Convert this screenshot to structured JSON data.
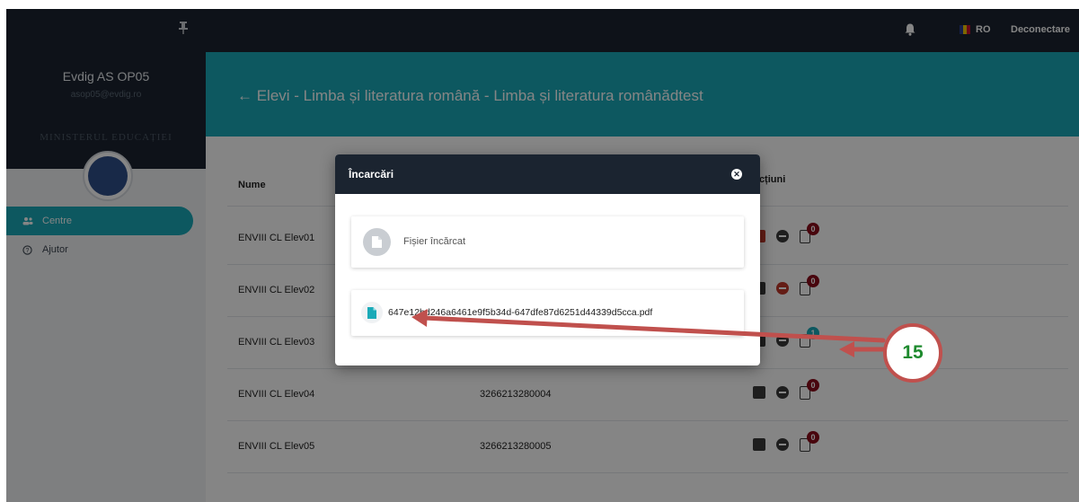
{
  "app": {
    "user_name": "Evdig AS OP05",
    "user_email": "asop05@evdig.ro",
    "ministry": "MINISTERUL EDUCAȚIEI"
  },
  "sidebar": {
    "items": [
      {
        "label": "Centre",
        "active": true
      },
      {
        "label": "Ajutor",
        "active": false
      }
    ]
  },
  "topbar": {
    "language": "RO",
    "logout": "Deconectare"
  },
  "header": {
    "title": "← Elevi - Limba și literatura română - Limba și literatura românădtest"
  },
  "table": {
    "columns": {
      "name": "Nume",
      "actions": "Acțiuni"
    },
    "rows": [
      {
        "name": "ENVIII CL Elev01",
        "code": "",
        "uploads": "0"
      },
      {
        "name": "ENVIII CL Elev02",
        "code": "",
        "uploads": "0"
      },
      {
        "name": "ENVIII CL Elev03",
        "code": "",
        "uploads": "1"
      },
      {
        "name": "ENVIII CL Elev04",
        "code": "3266213280004",
        "uploads": "0"
      },
      {
        "name": "ENVIII CL Elev05",
        "code": "3266213280005",
        "uploads": "0"
      }
    ]
  },
  "modal": {
    "title": "Încarcări",
    "upload_label": "Fișier încărcat",
    "file_name": "647e12bd246a6461e9f5b34d-647dfe87d6251d44339d5cca.pdf"
  },
  "annotation": {
    "step": "15"
  },
  "colors": {
    "teal": "#1aaab8",
    "navy": "#1b2430",
    "badge_red": "#8b0a1a",
    "badge_teal": "#1aaab8",
    "arrow": "#c0504d",
    "step_text": "#1e8a2e"
  }
}
